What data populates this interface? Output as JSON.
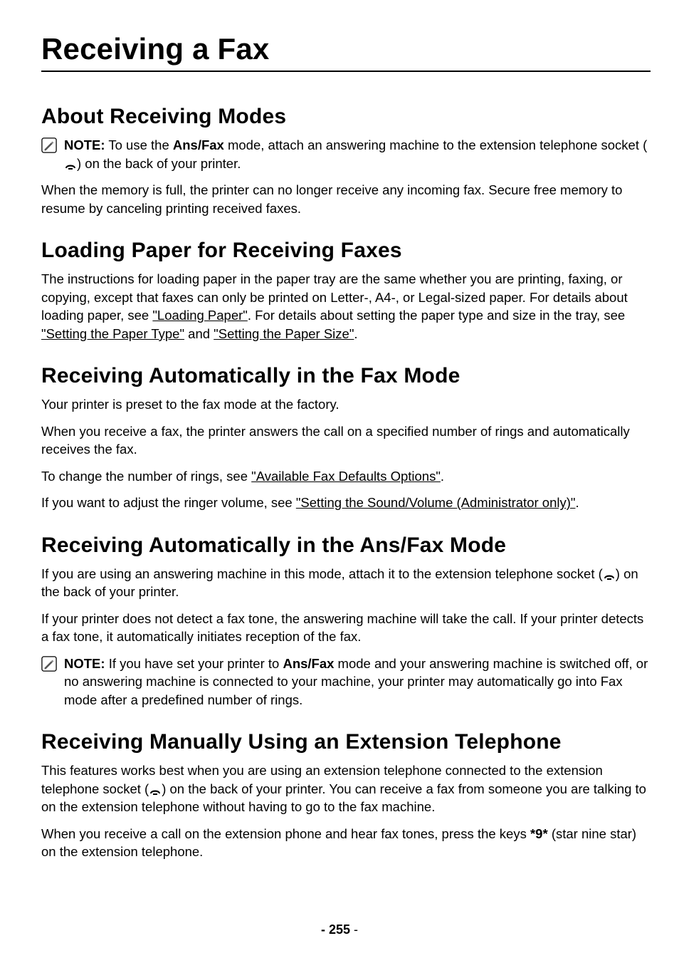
{
  "title": "Receiving a Fax",
  "sections": {
    "about": {
      "heading": "About Receiving Modes",
      "note_label": "NOTE:",
      "note_pre": " To use the ",
      "note_bold": "Ans/Fax",
      "note_mid": " mode, attach an answering machine to the extension telephone socket (",
      "note_post": ") on the back of your printer.",
      "para": "When the memory is full, the printer can no longer receive any incoming fax. Secure free memory to resume by canceling printing received faxes."
    },
    "loading": {
      "heading": "Loading Paper for Receiving Faxes",
      "p_pre": "The instructions for loading paper in the paper tray are the same whether you are printing, faxing, or copying, except that faxes can only be printed on Letter-, A4-, or Legal-sized paper. For details about loading paper, see ",
      "link1": "\"Loading Paper\"",
      "p_mid1": ". For details about setting the paper type and size in the tray, see ",
      "link2": "\"Setting the Paper Type\"",
      "p_mid2": " and ",
      "link3": "\"Setting the Paper Size\"",
      "p_post": "."
    },
    "auto_fax": {
      "heading": "Receiving Automatically in the Fax Mode",
      "p1": "Your printer is preset to the fax mode at the factory.",
      "p2": "When you receive a fax, the printer answers the call on a specified number of rings and automatically receives the fax.",
      "p3_pre": "To change the number of rings, see ",
      "p3_link": "\"Available Fax Defaults Options\"",
      "p3_post": ".",
      "p4_pre": "If you want to adjust the ringer volume, see ",
      "p4_link": "\"Setting the Sound/Volume (Administrator only)\"",
      "p4_post": "."
    },
    "auto_ans": {
      "heading": "Receiving Automatically in the Ans/Fax Mode",
      "p1_pre": "If you are using an answering machine in this mode, attach it to the extension telephone socket (",
      "p1_post": ") on the back of your printer.",
      "p2": "If your printer does not detect a fax tone, the answering machine will take the call. If your printer detects a fax tone, it automatically initiates reception of the fax.",
      "note_label": "NOTE:",
      "note_pre": " If you have set your printer to ",
      "note_bold": "Ans/Fax",
      "note_post": " mode and your answering machine is switched off, or no answering machine is connected to your machine, your printer may automatically go into Fax mode after a predefined number of rings."
    },
    "manual": {
      "heading": "Receiving Manually Using an Extension Telephone",
      "p1_pre": "This features works best when you are using an extension telephone connected to the extension telephone socket (",
      "p1_post": ") on the back of your printer. You can receive a fax from someone you are talking to on the extension telephone without having to go to the fax machine.",
      "p2_pre": "When you receive a call on the extension phone and hear fax tones, press the keys ",
      "p2_bold": "*9*",
      "p2_post": " (star nine star) on the extension telephone."
    }
  },
  "page_number_prefix": "- ",
  "page_number": "255",
  "page_number_suffix": " -"
}
